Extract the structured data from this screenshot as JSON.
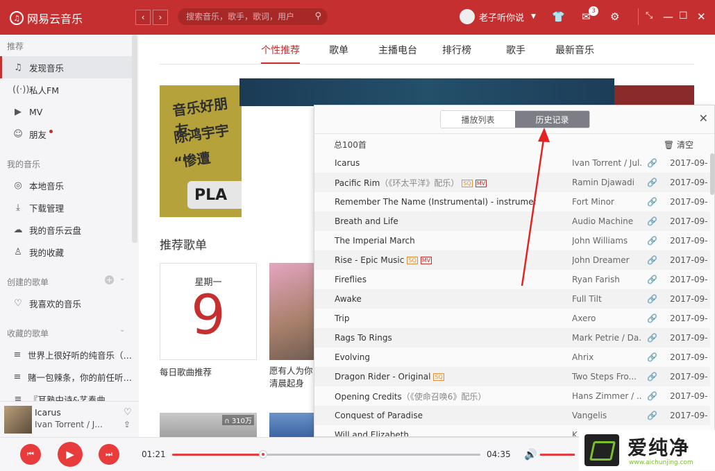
{
  "app": {
    "name": "网易云音乐",
    "logo_icon": "netease-music-logo-icon"
  },
  "titlebar": {
    "search_placeholder": "搜索音乐，歌手，歌词，用户",
    "username": "老子听你说",
    "message_count": "3",
    "bg_color": "#c62f2f"
  },
  "sidebar": {
    "section_recommend": "推荐",
    "recommend_items": [
      "发现音乐",
      "私人FM",
      "MV",
      "朋友"
    ],
    "section_my_music": "我的音乐",
    "my_music_items": [
      "本地音乐",
      "下载管理",
      "我的音乐云盘",
      "我的收藏"
    ],
    "section_created": "创建的歌单",
    "created_items": [
      "我喜欢的音乐"
    ],
    "section_collected": "收藏的歌单",
    "collected_items": [
      "世界上很好听的纯音乐（…",
      "赌一包辣条，你的前任听…",
      "『耳熟中诗&艺奏曲"
    ]
  },
  "mini_player": {
    "title": "Icarus",
    "artist": "Ivan Torrent / J..."
  },
  "tabs": [
    "个性推荐",
    "歌单",
    "主播电台",
    "排行榜",
    "歌手",
    "最新音乐"
  ],
  "active_tab": 0,
  "banner": {
    "left_lines": [
      "音乐好朋友",
      "陈鸿宇宇",
      "“惨遭"
    ],
    "left_plate": "PLA"
  },
  "recommend": {
    "title": "推荐歌单",
    "daily_weekday": "星期一",
    "daily_day": "9",
    "daily_caption": "每日歌曲推荐",
    "card2_caption": "愿有人为你清晨起身",
    "card3_playcount": "310万"
  },
  "panel": {
    "tab_playlist": "播放列表",
    "tab_history": "历史记录",
    "total": "总100首",
    "clear_label": "清空",
    "rows": [
      {
        "name": "Icarus",
        "sub": "",
        "tags": [],
        "artist": "Ivan Torrent / Jul...",
        "date": "2017-09-"
      },
      {
        "name": "Pacific Rim",
        "sub": "（《环太平洋》配乐）",
        "tags": [
          "SQ",
          "MV"
        ],
        "artist": "Ramin Djawadi",
        "date": "2017-09-"
      },
      {
        "name": "Remember The Name (Instrumental) - instrumental",
        "sub": "",
        "tags": [],
        "artist": "Fort Minor",
        "date": "2017-09-"
      },
      {
        "name": "Breath and Life",
        "sub": "",
        "tags": [],
        "artist": "Audio Machine",
        "date": "2017-09-"
      },
      {
        "name": "The Imperial March",
        "sub": "",
        "tags": [],
        "artist": "John Williams",
        "date": "2017-09-"
      },
      {
        "name": "Rise - Epic Music",
        "sub": "",
        "tags": [
          "SQ",
          "MV"
        ],
        "artist": "John Dreamer",
        "date": "2017-09-"
      },
      {
        "name": "Fireflies",
        "sub": "",
        "tags": [],
        "artist": "Ryan Farish",
        "date": "2017-09-"
      },
      {
        "name": "Awake",
        "sub": "",
        "tags": [],
        "artist": "Full Tilt",
        "date": "2017-09-"
      },
      {
        "name": "Trip",
        "sub": "",
        "tags": [],
        "artist": "Axero",
        "date": "2017-09-"
      },
      {
        "name": "Rags To Rings",
        "sub": "",
        "tags": [],
        "artist": "Mark Petrie / Da...",
        "date": "2017-09-"
      },
      {
        "name": "Evolving",
        "sub": "",
        "tags": [],
        "artist": "Ahrix",
        "date": "2017-09-"
      },
      {
        "name": "Dragon Rider - Original",
        "sub": "",
        "tags": [
          "SQ"
        ],
        "artist": "Two Steps Fro...",
        "date": "2017-09-"
      },
      {
        "name": "Opening Credits",
        "sub": "（《使命召唤6》配乐）",
        "tags": [],
        "artist": "Hans Zimmer / ...",
        "date": "2017-09-"
      },
      {
        "name": "Conquest of Paradise",
        "sub": "",
        "tags": [],
        "artist": "Vangelis",
        "date": "2017-09-"
      },
      {
        "name": "Will and Elizabeth",
        "sub": "",
        "tags": [],
        "artist": "K",
        "date": "2017-09-"
      }
    ]
  },
  "player": {
    "current_time": "01:21",
    "total_time": "04:35",
    "progress": 0.295,
    "volume": 1.0
  },
  "watermark": {
    "text": "爱纯净",
    "url": "www.aichunjing.com"
  }
}
